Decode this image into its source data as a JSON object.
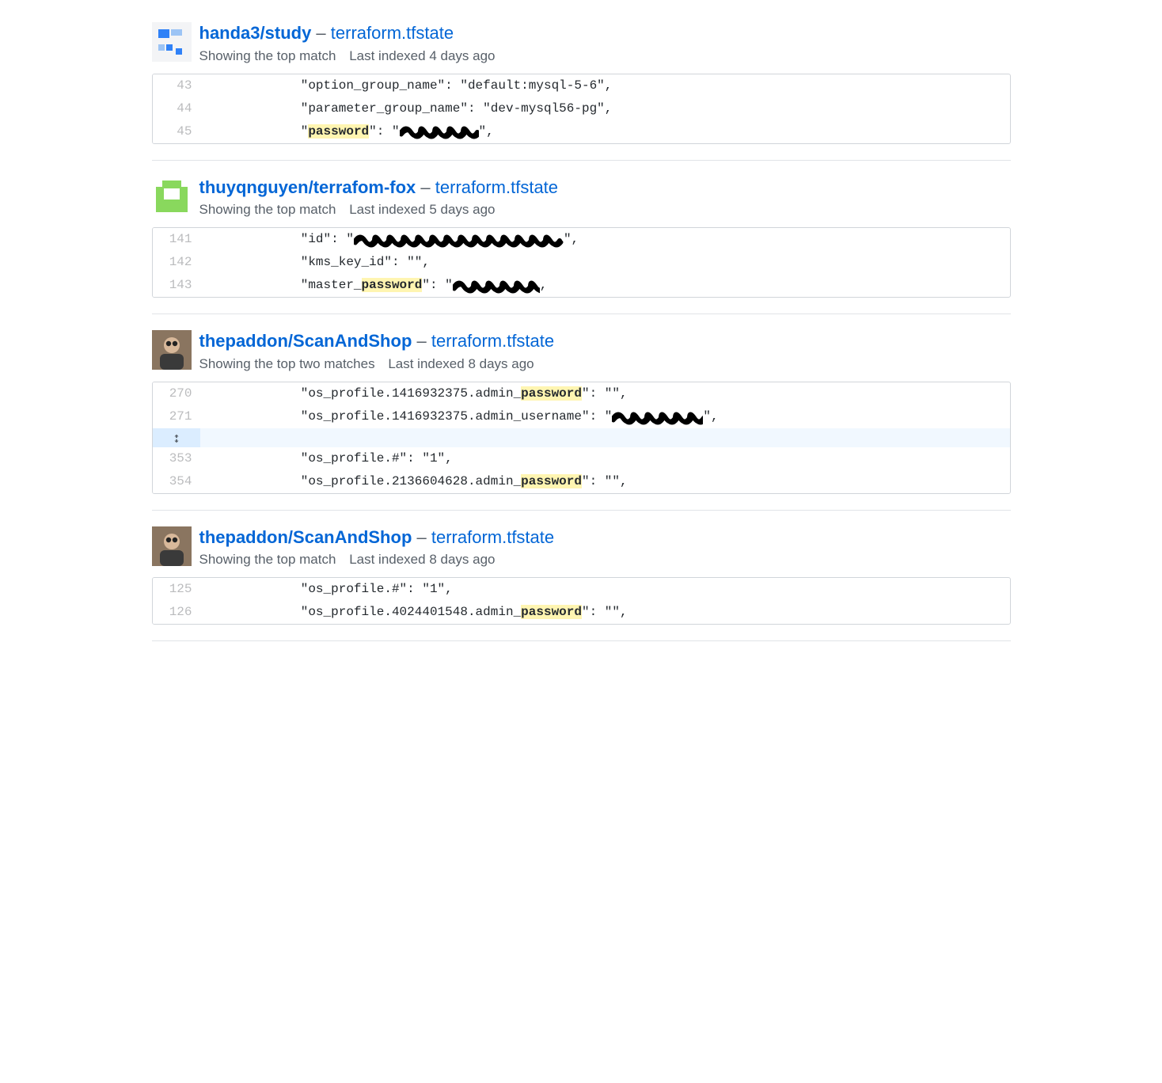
{
  "highlight_term": "password",
  "results": [
    {
      "avatar": "blue-squares",
      "repo": "handa3/study",
      "file": "terraform.tfstate",
      "match_text": "Showing the top match",
      "indexed_text": "Last indexed 4 days ago",
      "lines": [
        {
          "num": 43,
          "segments": [
            {
              "t": "            \"option_group_name\": \"default:mysql-5-6\","
            }
          ]
        },
        {
          "num": 44,
          "segments": [
            {
              "t": "            \"parameter_group_name\": \"dev-mysql56-pg\","
            }
          ]
        },
        {
          "num": 45,
          "segments": [
            {
              "t": "            \""
            },
            {
              "t": "password",
              "hl": true
            },
            {
              "t": "\": \""
            },
            {
              "redact": 100,
              "h": 18
            },
            {
              "t": "\","
            }
          ]
        }
      ]
    },
    {
      "avatar": "green-block",
      "repo": "thuyqnguyen/terrafom-fox",
      "file": "terraform.tfstate",
      "match_text": "Showing the top match",
      "indexed_text": "Last indexed 5 days ago",
      "lines": [
        {
          "num": 141,
          "segments": [
            {
              "t": "            \"id\": \""
            },
            {
              "redact": 265,
              "h": 18
            },
            {
              "t": "\","
            }
          ]
        },
        {
          "num": 142,
          "segments": [
            {
              "t": "            \"kms_key_id\": \"\","
            }
          ]
        },
        {
          "num": 143,
          "segments": [
            {
              "t": "            \"master_"
            },
            {
              "t": "password",
              "hl": true
            },
            {
              "t": "\": \""
            },
            {
              "redact": 110,
              "h": 18
            },
            {
              "t": ","
            }
          ]
        }
      ]
    },
    {
      "avatar": "photo",
      "repo": "thepaddon/ScanAndShop",
      "file": "terraform.tfstate",
      "match_text": "Showing the top two matches",
      "indexed_text": "Last indexed 8 days ago",
      "lines": [
        {
          "num": 270,
          "segments": [
            {
              "t": "            \"os_profile.1416932375.admin_"
            },
            {
              "t": "password",
              "hl": true
            },
            {
              "t": "\": \"\","
            }
          ]
        },
        {
          "num": 271,
          "segments": [
            {
              "t": "            \"os_profile.1416932375.admin_username\": \""
            },
            {
              "redact": 115,
              "h": 18
            },
            {
              "t": "\","
            }
          ]
        },
        {
          "expander": true
        },
        {
          "num": 353,
          "segments": [
            {
              "t": "            \"os_profile.#\": \"1\","
            }
          ]
        },
        {
          "num": 354,
          "segments": [
            {
              "t": "            \"os_profile.2136604628.admin_"
            },
            {
              "t": "password",
              "hl": true
            },
            {
              "t": "\": \"\","
            }
          ]
        }
      ]
    },
    {
      "avatar": "photo",
      "repo": "thepaddon/ScanAndShop",
      "file": "terraform.tfstate",
      "match_text": "Showing the top match",
      "indexed_text": "Last indexed 8 days ago",
      "lines": [
        {
          "num": 125,
          "segments": [
            {
              "t": "            \"os_profile.#\": \"1\","
            }
          ]
        },
        {
          "num": 126,
          "segments": [
            {
              "t": "            \"os_profile.4024401548.admin_"
            },
            {
              "t": "password",
              "hl": true
            },
            {
              "t": "\": \"\","
            }
          ]
        }
      ]
    }
  ]
}
